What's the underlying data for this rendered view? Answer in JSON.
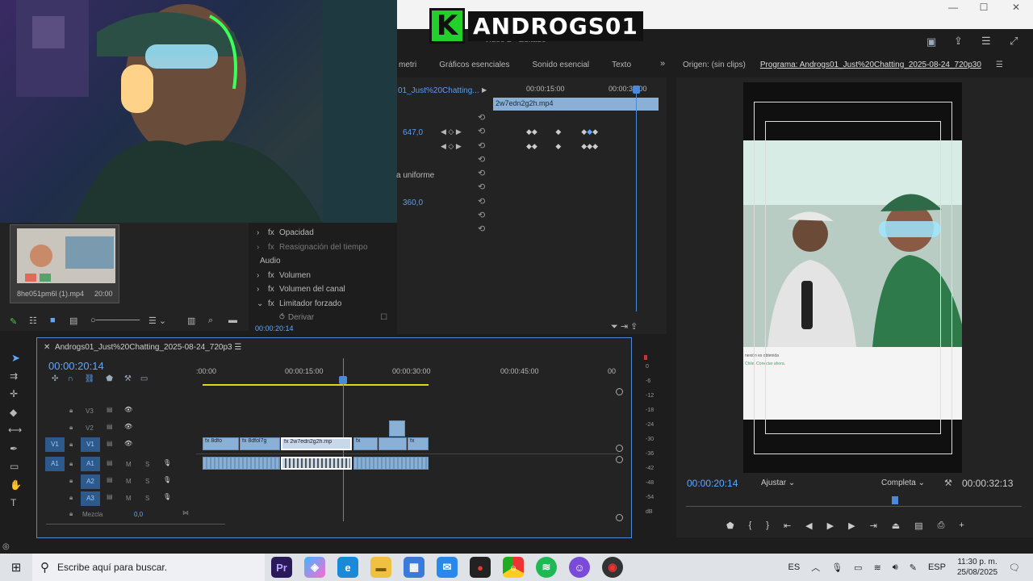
{
  "logo": {
    "k": "K",
    "name": "ANDROGS01"
  },
  "window": {
    "subtitle": "Video 2 - Editado",
    "minimize": "—",
    "maximize": "☐",
    "close": "✕"
  },
  "panel_tabs": [
    "metri",
    "Gráficos esenciales",
    "Sonido esencial",
    "Texto"
  ],
  "monitor_tabs": {
    "source": "Origen: (sin clips)",
    "program": "Programa: Androgs01_Just%20Chatting_2025-08-24_720p30"
  },
  "effect_controls": {
    "clip_label": "01_Just%20Chatting...",
    "clip_bar": "2w7edn2g2h.mp4",
    "time_a": "00:00:15:00",
    "time_b": "00:00:30:00",
    "value1": "647,0",
    "uniform_scale": "a uniforme",
    "value2": "360,0",
    "opacity": "Opacidad",
    "time_remap": "Reasignación del tiempo",
    "audio_header": "Audio",
    "volume": "Volumen",
    "channel_volume": "Volumen del canal",
    "hard_limiter": "Limitador forzado",
    "bypass": "Derivar",
    "current_time": "00:00:20:14"
  },
  "project": {
    "thumb_name": "8he051pm6l (1).mp4",
    "thumb_duration": "20:00"
  },
  "timeline": {
    "sequence_name": "Androgs01_Just%20Chatting_2025-08-24_720p3",
    "current_time": "00:00:20:14",
    "ruler": [
      ":00:00",
      "00:00:15:00",
      "00:00:30:00",
      "00:00:45:00",
      "00"
    ],
    "tracks_video": [
      "V3",
      "V2",
      "V1"
    ],
    "tracks_audio": [
      "A1",
      "A2",
      "A3"
    ],
    "mix_label": "Mezcla",
    "mix_value": "0,0",
    "clips": [
      "8dfo",
      "8dfol7g",
      "2w7edn2g2h.mp",
      "",
      "",
      ""
    ],
    "m": "M",
    "s": "S"
  },
  "meter": [
    "0",
    "-6",
    "-12",
    "-18",
    "-24",
    "-30",
    "-36",
    "-42",
    "-48",
    "-54",
    "dB"
  ],
  "program": {
    "time": "00:00:20:14",
    "fit": "Ajustar",
    "quality": "Completa",
    "duration": "00:00:32:13",
    "overlay_text1": "nexión es obtenida",
    "overlay_text2": "Chile. Conectar ahora."
  },
  "taskbar": {
    "search_placeholder": "Escribe aquí para buscar.",
    "pr": "Pr",
    "lang": "ES",
    "lang2": "ESP",
    "time": "11:30 p. m.",
    "date": "25/08/2025"
  },
  "colors": {
    "accent": "#5fa8ff",
    "brand_green": "#22d02a",
    "clip": "#8ab0d6",
    "playhead": "#4a8ad8"
  }
}
